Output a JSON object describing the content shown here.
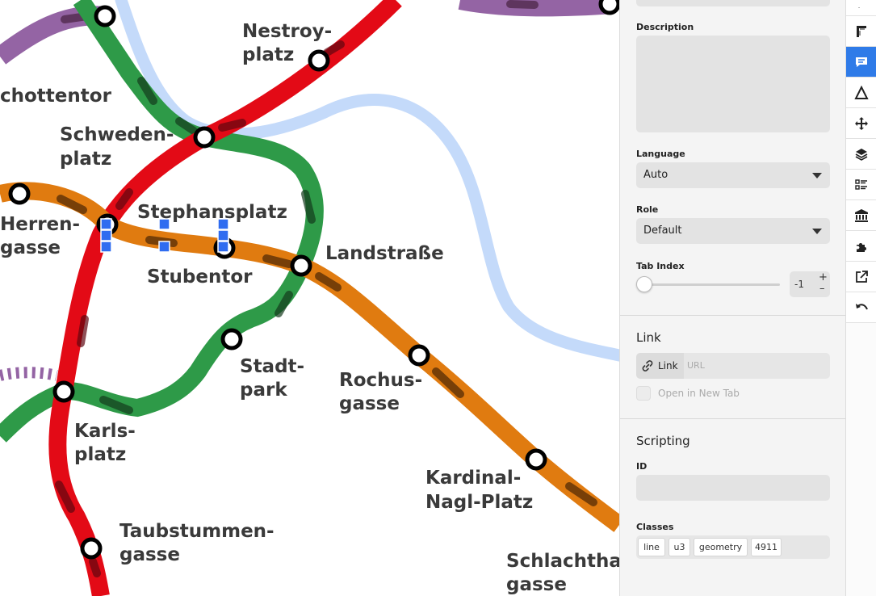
{
  "map": {
    "stations": {
      "schottentor": "chottentor",
      "nestroyplatz_1": "Nestroy-",
      "nestroyplatz_2": "platz",
      "schwedenplatz_1": "Schweden-",
      "schwedenplatz_2": "platz",
      "herrengasse_1": "Herren-",
      "herrengasse_2": "gasse",
      "stephansplatz": "Stephansplatz",
      "stubentor": "Stubentor",
      "landstrasse": "Landstraße",
      "stadtpark_1": "Stadt-",
      "stadtpark_2": "park",
      "rochusgasse_1": "Rochus-",
      "rochusgasse_2": "gasse",
      "karlsplatz_1": "Karls-",
      "karlsplatz_2": "platz",
      "kardinal_1": "Kardinal-",
      "kardinal_2": "Nagl-Platz",
      "taubstummen_1": "Taubstummen-",
      "taubstummen_2": "gasse",
      "schlachthaus_1": "Schlachthau",
      "schlachthaus_2": "gasse"
    },
    "line_colors": {
      "u1_red": "#e30a16",
      "u2_purple": "#9464a4",
      "u3_orange": "#e07b10",
      "u4_green": "#2e9a48",
      "river_blue": "#c4dafa"
    }
  },
  "panel": {
    "description_label": "Description",
    "description_value": "",
    "language_label": "Language",
    "language_value": "Auto",
    "role_label": "Role",
    "role_value": "Default",
    "tab_index_label": "Tab Index",
    "tab_index_value": "-1",
    "tab_index_slider_fraction": 0,
    "plus": "+",
    "minus": "–",
    "link_section_title": "Link",
    "link_button_label": "Link",
    "url_placeholder": "URL",
    "open_new_tab_label": "Open in New Tab",
    "open_new_tab_checked": false,
    "scripting_section_title": "Scripting",
    "id_label": "ID",
    "id_value": "",
    "classes_label": "Classes",
    "classes": [
      "line",
      "u3",
      "geometry",
      "4911"
    ]
  },
  "toolbar": {
    "tools": [
      {
        "name": "text-style-icon",
        "active": false
      },
      {
        "name": "ruler-icon",
        "active": false
      },
      {
        "name": "accessibility-comment-icon",
        "active": true
      },
      {
        "name": "triangle-icon",
        "active": false
      },
      {
        "name": "move-icon",
        "active": false
      },
      {
        "name": "layers-icon",
        "active": false
      },
      {
        "name": "list-icon",
        "active": false
      },
      {
        "name": "bank-icon",
        "active": false
      },
      {
        "name": "puzzle-icon",
        "active": false
      },
      {
        "name": "external-link-icon",
        "active": false
      },
      {
        "name": "undo-icon",
        "active": false
      }
    ],
    "accent_color": "#2f7be8"
  }
}
